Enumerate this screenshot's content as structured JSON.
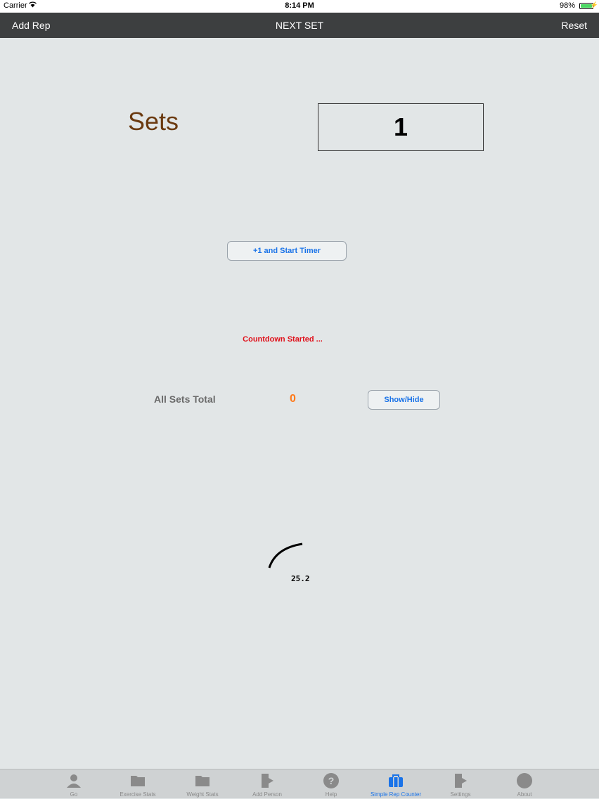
{
  "status_bar": {
    "carrier": "Carrier",
    "time": "8:14 PM",
    "battery": "98%"
  },
  "nav_bar": {
    "left_button": "Add Rep",
    "title": "NEXT SET",
    "right_button": "Reset"
  },
  "main": {
    "sets_label": "Sets",
    "sets_value": "1",
    "start_timer_button": "+1 and Start Timer",
    "countdown_status": "Countdown Started ...",
    "all_sets_total_label": "All Sets Total",
    "all_sets_total_value": "0",
    "show_hide_button": "Show/Hide",
    "timer_value": "25.2"
  },
  "tab_bar": {
    "tabs": [
      {
        "label": "Go",
        "icon": "person-icon",
        "active": false
      },
      {
        "label": "Exercise Stats",
        "icon": "folder-icon",
        "active": false
      },
      {
        "label": "Weight Stats",
        "icon": "folder-icon",
        "active": false
      },
      {
        "label": "Add Person",
        "icon": "document-arrow-icon",
        "active": false
      },
      {
        "label": "Help",
        "icon": "question-icon",
        "active": false
      },
      {
        "label": "Simple Rep Counter",
        "icon": "briefcase-icon",
        "active": true
      },
      {
        "label": "Settings",
        "icon": "document-arrow-icon",
        "active": false
      },
      {
        "label": "About",
        "icon": "circle-icon",
        "active": false
      }
    ]
  },
  "colors": {
    "active_tab": "#1a73e8",
    "countdown_status": "#e0101a",
    "total_value": "#ff7a1a",
    "sets_label": "#6b3a10"
  }
}
